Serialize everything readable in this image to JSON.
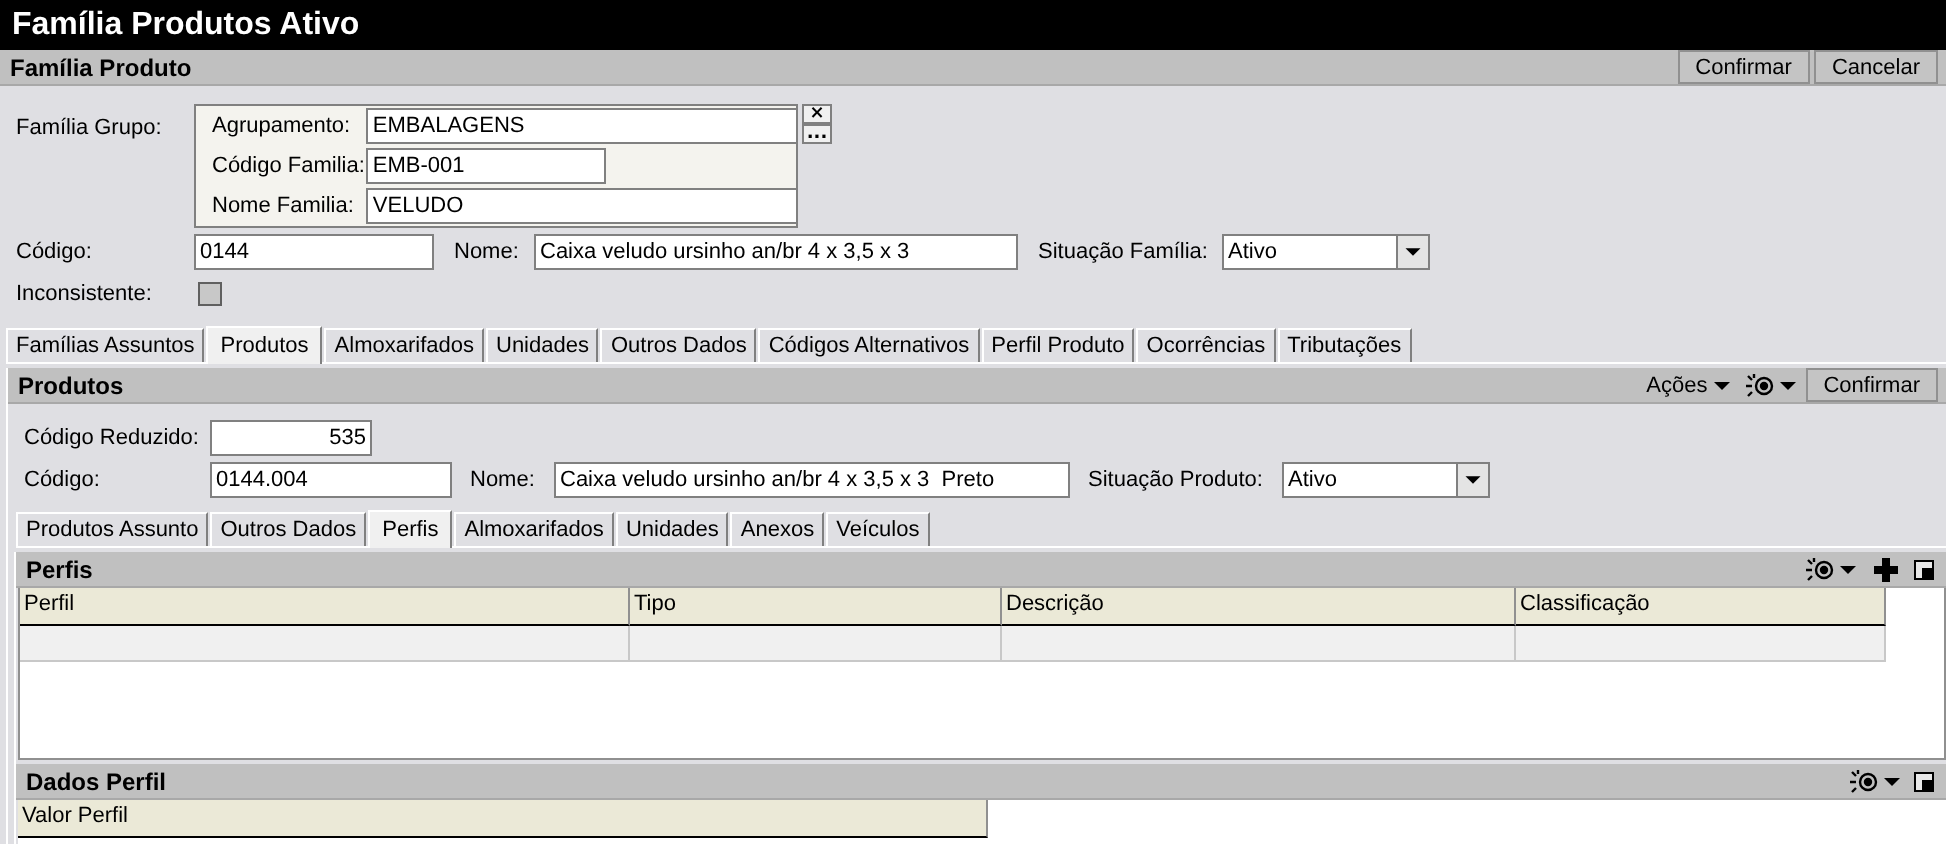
{
  "window": {
    "title": "Família Produtos Ativo"
  },
  "familia_panel": {
    "title": "Família Produto",
    "actions": [
      {
        "kind": "button",
        "label": "Confirmar"
      },
      {
        "kind": "button",
        "label": "Cancelar"
      }
    ]
  },
  "familia_grupo": {
    "label": "Família Grupo:",
    "fields": [
      {
        "label": "Agrupamento:",
        "value": "EMBALAGENS"
      },
      {
        "label": "Código Familia:",
        "value": "EMB-001"
      },
      {
        "label": "Nome Familia:",
        "value": "VELUDO"
      }
    ],
    "buttons": [
      "×",
      "..."
    ]
  },
  "familia_fields": [
    {
      "label": "Código:",
      "value": "0144",
      "kind": "text"
    },
    {
      "label": "Nome:",
      "value": "Caixa veludo ursinho an/br 4 x 3,5 x 3",
      "kind": "text"
    },
    {
      "label": "Situação Família:",
      "value": "Ativo",
      "kind": "select"
    }
  ],
  "inconsistente": {
    "label": "Inconsistente:",
    "checked": false
  },
  "tabs": [
    {
      "label": "Famílias Assuntos",
      "selected": false
    },
    {
      "label": "Produtos",
      "selected": true
    },
    {
      "label": "Almoxarifados",
      "selected": false
    },
    {
      "label": "Unidades",
      "selected": false
    },
    {
      "label": "Outros Dados",
      "selected": false
    },
    {
      "label": "Códigos Alternativos",
      "selected": false
    },
    {
      "label": "Perfil Produto",
      "selected": false
    },
    {
      "label": "Ocorrências",
      "selected": false
    },
    {
      "label": "Tributações",
      "selected": false
    }
  ],
  "produtos_panel": {
    "title": "Produtos",
    "actions": [
      {
        "kind": "menu",
        "label": "Ações"
      },
      {
        "kind": "view-menu"
      },
      {
        "kind": "button",
        "label": "Confirmar"
      }
    ]
  },
  "codigo_reduzido": {
    "label": "Código Reduzido:",
    "value": "535"
  },
  "produto_fields": [
    {
      "label": "Código:",
      "value": "0144.004",
      "kind": "text"
    },
    {
      "label": "Nome:",
      "value": "Caixa veludo ursinho an/br 4 x 3,5 x 3  Preto",
      "kind": "text"
    },
    {
      "label": "Situação Produto:",
      "value": "Ativo",
      "kind": "select"
    }
  ],
  "subtabs": [
    {
      "label": "Produtos Assunto",
      "selected": false
    },
    {
      "label": "Outros Dados",
      "selected": false
    },
    {
      "label": "Perfis",
      "selected": true
    },
    {
      "label": "Almoxarifados",
      "selected": false
    },
    {
      "label": "Unidades",
      "selected": false
    },
    {
      "label": "Anexos",
      "selected": false
    },
    {
      "label": "Veículos",
      "selected": false
    }
  ],
  "perfis_panel": {
    "title": "Perfis",
    "actions": [
      {
        "kind": "view-menu"
      },
      {
        "kind": "add"
      },
      {
        "kind": "restore"
      }
    ]
  },
  "perfis_table": {
    "columns": [
      "Perfil",
      "Tipo",
      "Descrição",
      "Classificação"
    ]
  },
  "dados_perfil_panel": {
    "title": "Dados Perfil",
    "actions": [
      {
        "kind": "view-menu"
      },
      {
        "kind": "restore"
      }
    ]
  },
  "dados_perfil_table": {
    "columns": [
      "Valor Perfil"
    ]
  }
}
